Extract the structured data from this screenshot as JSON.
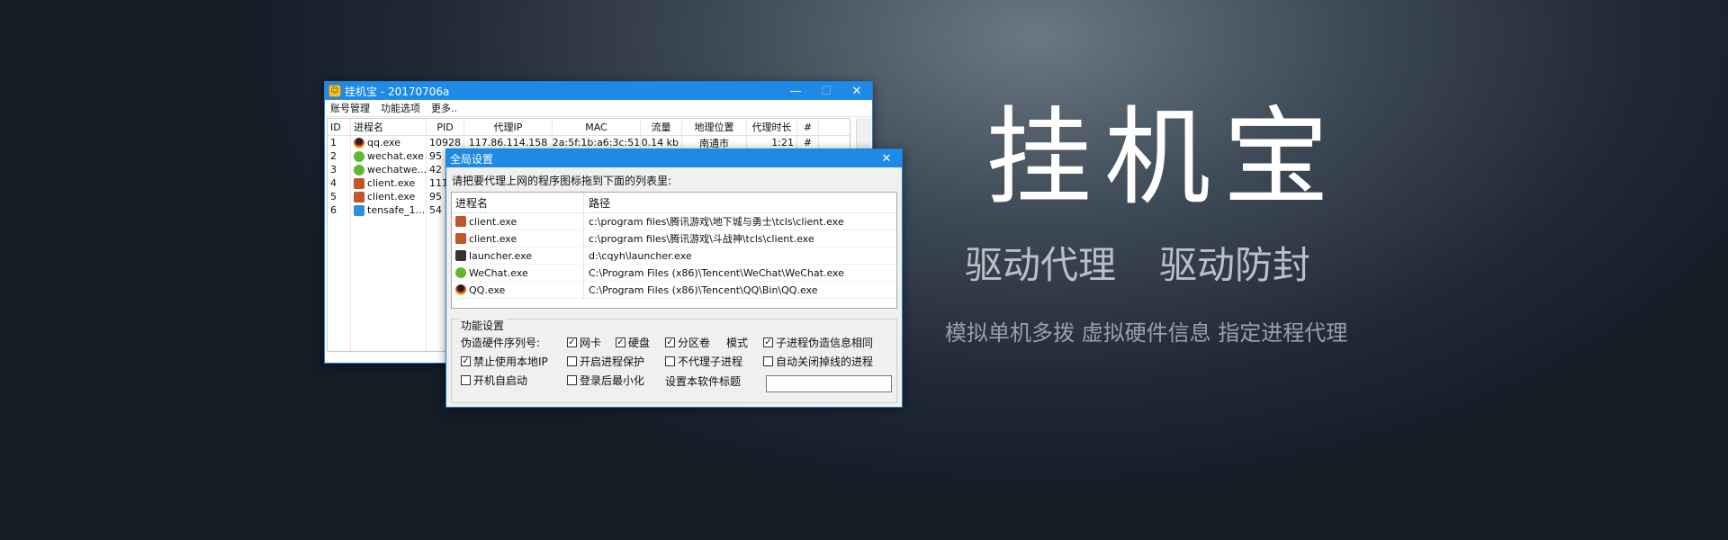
{
  "main_window": {
    "title": "挂机宝 - 20170706a",
    "controls": {
      "minimize": "—",
      "maximize": "☐",
      "close": "✕"
    },
    "menu": [
      "账号管理",
      "功能选项",
      "更多.."
    ],
    "columns": [
      "ID",
      "进程名",
      "PID",
      "代理IP",
      "MAC",
      "流量",
      "地理位置",
      "代理时长",
      "#"
    ],
    "rows": [
      {
        "id": "1",
        "icon": "qq",
        "name": "qq.exe",
        "pid": "10928",
        "ip": "117.86.114.158",
        "mac": "2a:5f:1b:a6:3c:51",
        "flow": "0.14 kb",
        "geo": "南通市",
        "dur": "1:21",
        "hash": "#"
      },
      {
        "id": "2",
        "icon": "wechat",
        "name": "wechat.exe",
        "pid": "95",
        "ip": "",
        "mac": "",
        "flow": "",
        "geo": "",
        "dur": "",
        "hash": ""
      },
      {
        "id": "3",
        "icon": "wechat",
        "name": "wechatwe...",
        "pid": "42",
        "ip": "",
        "mac": "",
        "flow": "",
        "geo": "",
        "dur": "",
        "hash": ""
      },
      {
        "id": "4",
        "icon": "game",
        "name": "client.exe",
        "pid": "111",
        "ip": "",
        "mac": "",
        "flow": "",
        "geo": "",
        "dur": "",
        "hash": ""
      },
      {
        "id": "5",
        "icon": "game",
        "name": "client.exe",
        "pid": "95",
        "ip": "",
        "mac": "",
        "flow": "",
        "geo": "",
        "dur": "",
        "hash": ""
      },
      {
        "id": "6",
        "icon": "ts",
        "name": "tensafe_1....",
        "pid": "54",
        "ip": "",
        "mac": "",
        "flow": "",
        "geo": "",
        "dur": "",
        "hash": ""
      }
    ]
  },
  "dialog": {
    "title": "全局设置",
    "close": "✕",
    "instruction": "请把要代理上网的程序图标拖到下面的列表里:",
    "columns": [
      "进程名",
      "路径"
    ],
    "programs": [
      {
        "icon": "game",
        "name": "client.exe",
        "path": "c:\\program files\\腾讯游戏\\地下城与勇士\\tcls\\client.exe"
      },
      {
        "icon": "game",
        "name": "client.exe",
        "path": "c:\\program files\\腾讯游戏\\斗战神\\tcls\\client.exe"
      },
      {
        "icon": "launch",
        "name": "launcher.exe",
        "path": "d:\\cqyh\\launcher.exe"
      },
      {
        "icon": "wechat",
        "name": "WeChat.exe",
        "path": "C:\\Program Files (x86)\\Tencent\\WeChat\\WeChat.exe"
      },
      {
        "icon": "qq",
        "name": "QQ.exe",
        "path": "C:\\Program Files (x86)\\Tencent\\QQ\\Bin\\QQ.exe"
      }
    ],
    "group_title": "功能设置",
    "fake_hw_label": "伪造硬件序列号:",
    "options": {
      "nic": {
        "label": "网卡",
        "checked": true
      },
      "disk": {
        "label": "硬盘",
        "checked": true
      },
      "partition": {
        "label": "分区卷",
        "checked": true
      },
      "mode": {
        "label": "模式"
      },
      "child_same": {
        "label": "子进程伪造信息相同",
        "checked": true
      },
      "no_local_ip": {
        "label": "禁止使用本地IP",
        "checked": true
      },
      "protect": {
        "label": "开启进程保护",
        "checked": false
      },
      "no_child_proxy": {
        "label": "不代理子进程",
        "checked": false
      },
      "auto_close": {
        "label": "自动关闭掉线的进程",
        "checked": false
      },
      "autostart": {
        "label": "开机自启动",
        "checked": false
      },
      "minimize": {
        "label": "登录后最小化",
        "checked": false
      },
      "set_title": {
        "label": "设置本软件标题"
      }
    },
    "title_field_value": ""
  },
  "promo": {
    "title": "挂机宝",
    "sub1": "驱动代理",
    "sub2": "驱动防封",
    "line": "模拟单机多拨 虚拟硬件信息 指定进程代理"
  }
}
